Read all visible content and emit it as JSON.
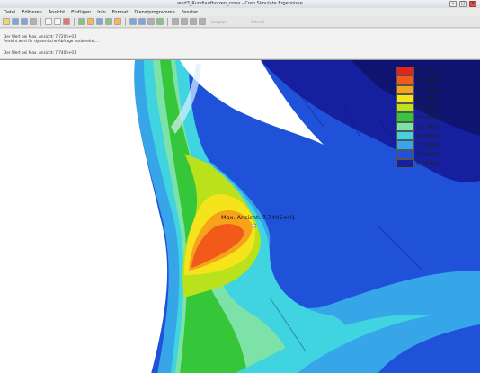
{
  "window": {
    "title": "wnd3_Rundlaufbolzen_cross - Creo Simulate Ergebnisse"
  },
  "menu": [
    "Datei",
    "Editieren",
    "Ansicht",
    "Einfügen",
    "Info",
    "Format",
    "Dienstprogramme",
    "Fenster"
  ],
  "toolbar": {
    "buttons": [
      "new-file-icon",
      "open-icon",
      "save-icon",
      "print-icon",
      "copy-icon",
      "paste-icon",
      "delete-icon",
      "move-icon",
      "edit-icon",
      "format-icon",
      "show-icon",
      "legend-icon",
      "spin-icon",
      "zoom-icon",
      "query-icon",
      "axis-icon",
      "play-icon",
      "step-back-icon",
      "step-forward-icon",
      "animate-icon"
    ],
    "anim_label": "Langsam",
    "anim_label2": "Schnell"
  },
  "messages": {
    "line1": "Der Wert bei Max. Ansicht: 7.7205+01",
    "line2": "Ansicht wird für dynamische Abfrage vorbereitet...",
    "line3": "Der Wert bei Max. Ansicht: 7.7405+01"
  },
  "legend": {
    "entries": [
      {
        "value": "119.814",
        "color": "#e3241b"
      },
      {
        "value": "80.0000",
        "color": "#f25a1a"
      },
      {
        "value": "71.0000",
        "color": "#f7a21b"
      },
      {
        "value": "62.0000",
        "color": "#f5e31c"
      },
      {
        "value": "53.0000",
        "color": "#b9e21c"
      },
      {
        "value": "44.0000",
        "color": "#36c63a"
      },
      {
        "value": "35.0000",
        "color": "#7de2a8"
      },
      {
        "value": "26.0000",
        "color": "#3fd4e0"
      },
      {
        "value": "17.0000",
        "color": "#37a6e8"
      },
      {
        "value": "8.00000",
        "color": "#1f52d9"
      },
      {
        "value": "0.00000",
        "color": "#16209e"
      }
    ]
  },
  "annotation": {
    "max_label": "Max. Ansicht: 7.7405+01"
  }
}
